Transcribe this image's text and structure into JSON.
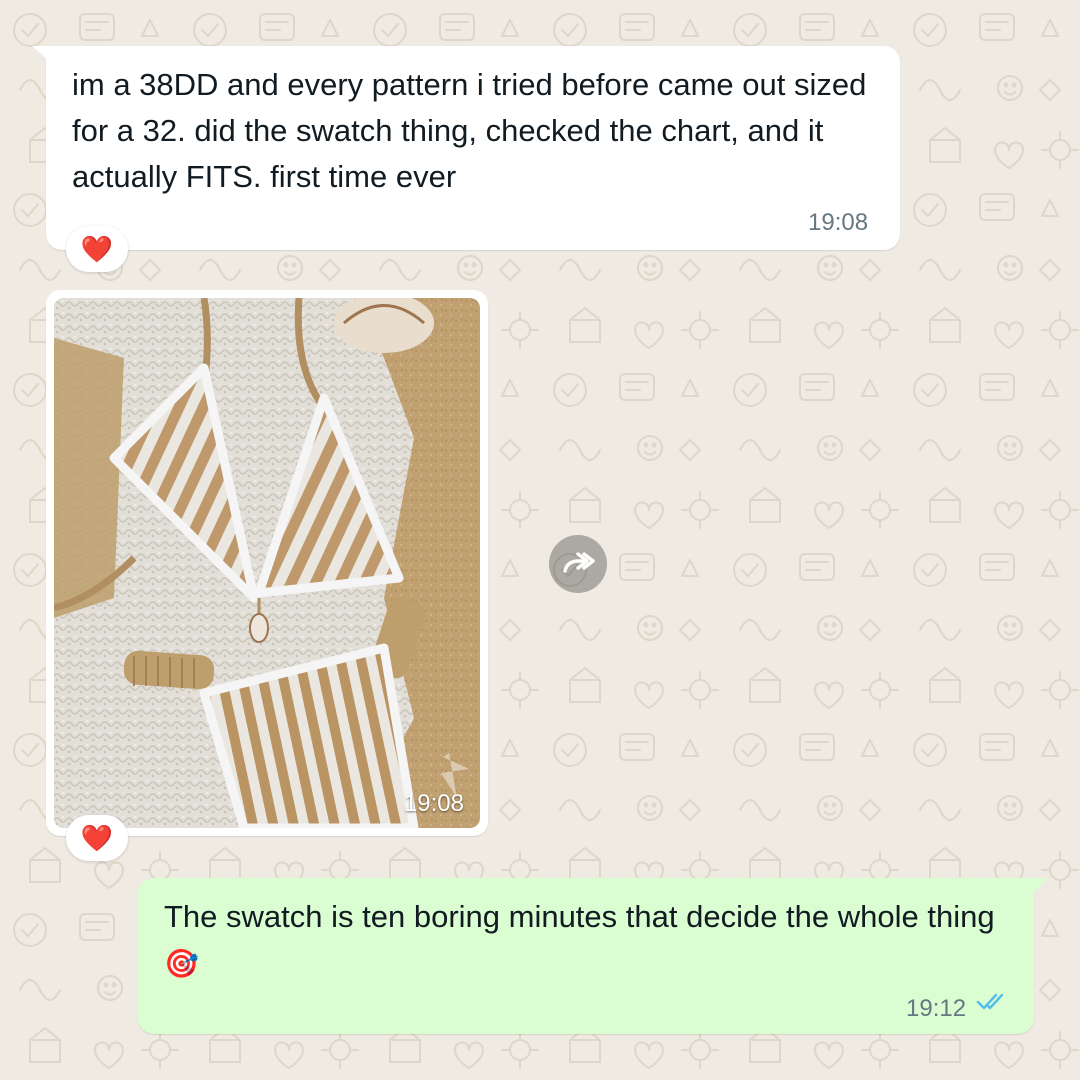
{
  "messages": [
    {
      "direction": "incoming",
      "type": "text",
      "text": "im a 38DD and every pattern i tried before came out sized for a 32. did the swatch thing, checked the chart, and it actually FITS. first time ever",
      "time": "19:08",
      "reaction": "❤️"
    },
    {
      "direction": "incoming",
      "type": "image",
      "image_icon": "crochet-bikini-photo",
      "time": "19:08",
      "reaction": "❤️",
      "forward_icon": "forward-icon"
    },
    {
      "direction": "outgoing",
      "type": "text",
      "text": "The swatch is ten boring minutes that decide the whole thing",
      "emoji": "🎯",
      "time": "19:12",
      "status_icon": "double-check-read-icon"
    }
  ],
  "colors": {
    "wallpaper": "#efeae2",
    "incoming_bubble": "#ffffff",
    "outgoing_bubble": "#dafdd1",
    "read_ticks": "#53bdeb",
    "timestamp": "#667781"
  }
}
